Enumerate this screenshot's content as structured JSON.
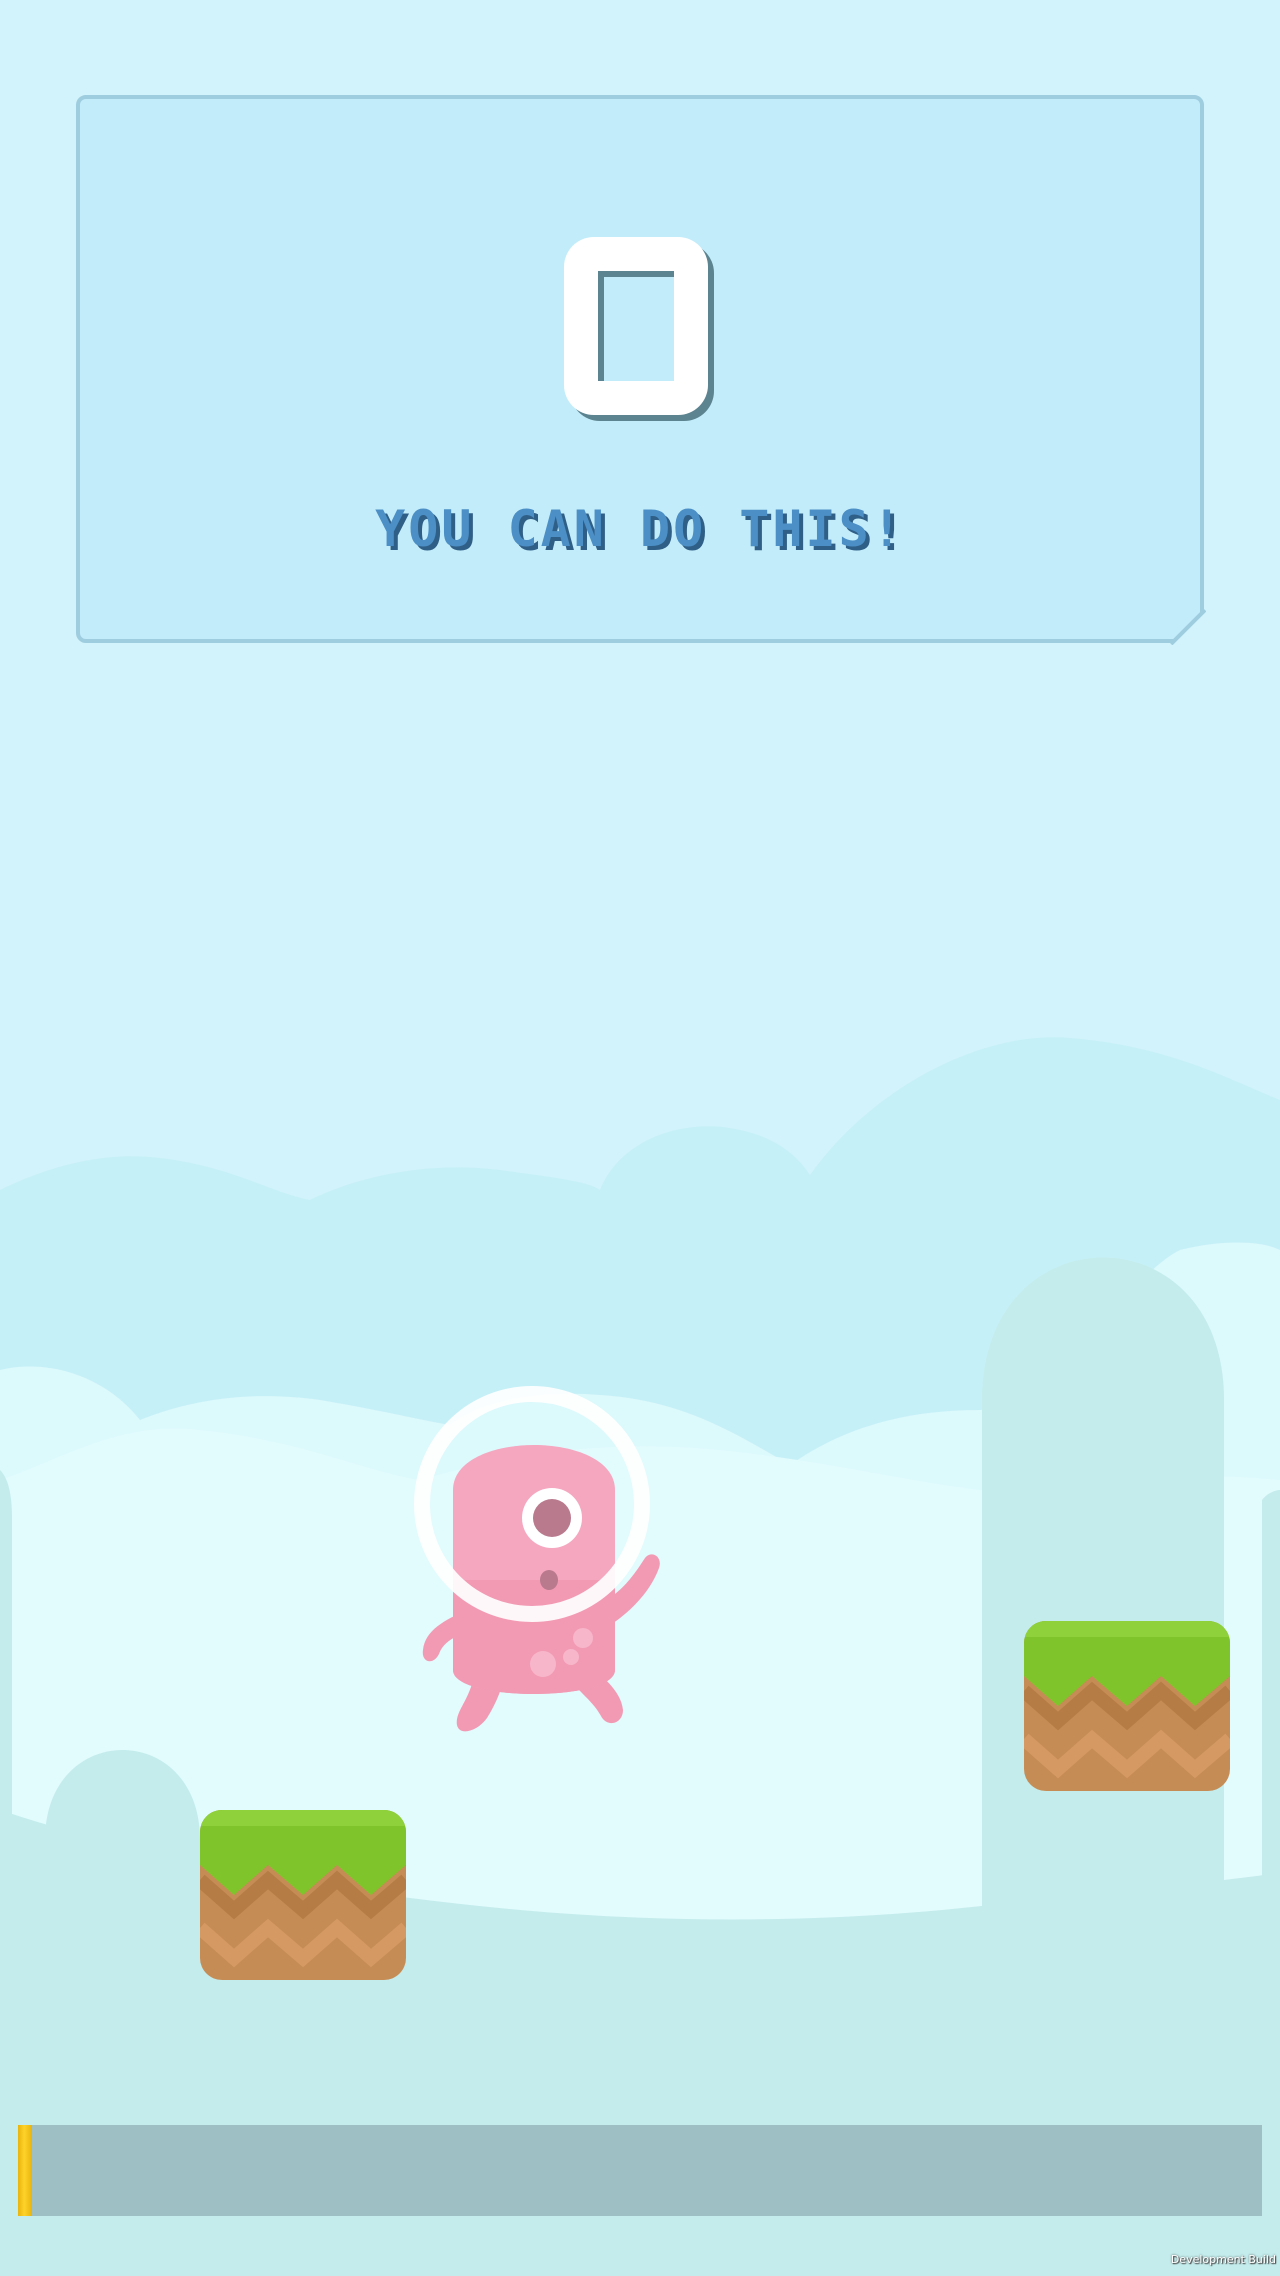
{
  "hud": {
    "score": "0",
    "message": "YOU CAN DO THIS!",
    "progress_fraction": 0.011
  },
  "footer": {
    "build_label": "Development Build"
  },
  "colors": {
    "sky": "#d2f3fb",
    "panel": "#c3ecfa",
    "panel_border": "#9fcde0",
    "message_text": "#4b8fc6",
    "grass": "#7fc42a",
    "dirt": "#c68c55",
    "alien_pink": "#f4a3bb",
    "progress_track": "#9ebfc3",
    "progress_fill": "#ffd22a"
  },
  "icons": {
    "player": "pink-one-eyed-alien-in-bubble-helmet",
    "platform": "grass-dirt-block"
  }
}
